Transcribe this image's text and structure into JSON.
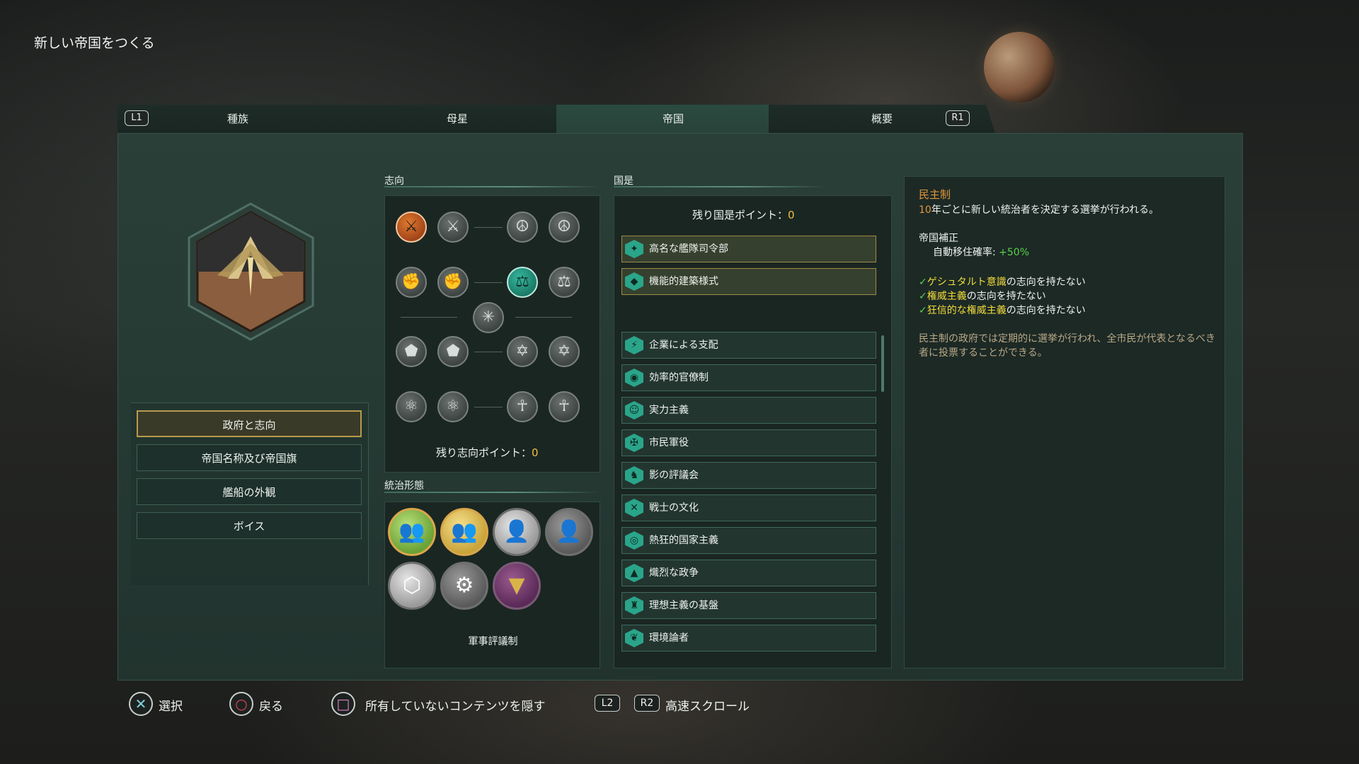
{
  "page_title": "新しい帝国をつくる",
  "tabs": {
    "left_key": "L1",
    "right_key": "R1",
    "items": [
      "種族",
      "母星",
      "帝国",
      "概要"
    ],
    "active": "帝国"
  },
  "left_menu": {
    "items": [
      "政府と志向",
      "帝国名称及び帝国旗",
      "艦船の外観",
      "ボイス"
    ],
    "active_index": 0
  },
  "ethics": {
    "title": "志向",
    "remaining_label": "残り志向ポイント：",
    "remaining_value": "0",
    "icons": [
      "fanatic-militarist-icon",
      "militarist-icon",
      "pacifist-icon",
      "fanatic-pacifist-icon",
      "fanatic-xenophobe-icon",
      "xenophobe-icon",
      "egalitarian-icon",
      "fanatic-egalitarian-icon",
      "gestalt-icon",
      "fanatic-authoritarian-icon",
      "authoritarian-icon",
      "xenophile-icon",
      "fanatic-xenophile-icon",
      "fanatic-materialist-icon",
      "materialist-icon",
      "spiritualist-icon",
      "fanatic-spiritualist-icon"
    ],
    "selected": [
      "fanatic-militarist-icon",
      "egalitarian-icon"
    ]
  },
  "authority": {
    "title": "統治形態",
    "icons": [
      "democracy-icon",
      "oligarchy-icon",
      "dictatorship-icon",
      "imperial-icon",
      "hive-mind-icon",
      "machine-intelligence-icon",
      "corporate-icon"
    ],
    "selected_name": "軍事評議制"
  },
  "civics": {
    "title": "国是",
    "remaining_label": "残り国是ポイント：",
    "remaining_value": "0",
    "chosen": [
      "高名な艦隊司令部",
      "機能的建築様式"
    ],
    "available": [
      "企業による支配",
      "効率的官僚制",
      "実力主義",
      "市民軍役",
      "影の評議会",
      "戦士の文化",
      "熱狂的国家主義",
      "熾烈な政争",
      "理想主義の基盤",
      "環境論者"
    ]
  },
  "description": {
    "title": "民主制",
    "line1_num": "10",
    "line1_text": "年ごとに新しい統治者を決定する選挙が行われる。",
    "bonus_title": "帝国補正",
    "bonus_label": "自動移住確率:",
    "bonus_value": "+50%",
    "req1_hl": "ゲシュタルト意識",
    "req1_text": "の志向を持たない",
    "req2_hl": "権威主義",
    "req2_text": "の志向を持たない",
    "req3_hl": "狂信的な権威主義",
    "req3_text": "の志向を持たない",
    "flavor": "民主制の政府では定期的に選挙が行われ、全市民が代表となるべき者に投票することができる。"
  },
  "hints": {
    "select": "選択",
    "back": "戻る",
    "hide": "所有していないコンテンツを隠す",
    "l2": "L2",
    "r2": "R2",
    "scroll": "高速スクロール"
  }
}
